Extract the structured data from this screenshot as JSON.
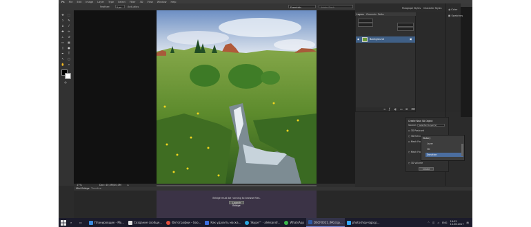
{
  "menubar": {
    "logo": "Ps",
    "items": [
      "File",
      "Edit",
      "Image",
      "Layer",
      "Type",
      "Select",
      "Filter",
      "3D",
      "View",
      "Window",
      "Help"
    ]
  },
  "options": {
    "essentials": "Essentials",
    "search_placeholder": "Adobe Stock",
    "label_feather": "Feather:",
    "feather_value": "0 px",
    "antialias": "Anti-alias"
  },
  "layers": {
    "tabs": [
      "Layers",
      "Channels",
      "Paths"
    ],
    "layer_name": "Background"
  },
  "panels_bar": {
    "tabs": [
      "Paragraph Styles",
      "Character Styles"
    ]
  },
  "right_panels": {
    "items": [
      "Color",
      "Swatches"
    ]
  },
  "panel3d": {
    "title": "Create New 3D Object",
    "source_label": "Source:",
    "source_value": "Selected Layer(s)",
    "options": [
      "3D Postcard",
      "3D Extrusion",
      "Mesh From Preset",
      "Mesh From Depth Map",
      "3D Volume"
    ],
    "create_label": "Create"
  },
  "popup": {
    "title": "History",
    "items": [
      "Layer",
      "3D",
      "Donation"
    ]
  },
  "status": {
    "zoom": "17%",
    "doc": "Doc: 40,0M/40,0M"
  },
  "bottom": {
    "tabs": [
      "Mini Bridge",
      "Timeline"
    ],
    "message": "Bridge must be running to browse files.",
    "button": "Launch Bridge"
  },
  "taskbar": {
    "items": [
      {
        "label": "Планировщик - Мо...",
        "color": "#3c8de0"
      },
      {
        "label": "Создание сообще...",
        "color": "#e0e0e0"
      },
      {
        "label": "Фотографии - Goo...",
        "color": "#e34d3c"
      },
      {
        "label": "Как удалить маска...",
        "color": "#3c6fe0"
      },
      {
        "label": "Skype™ - aleksandr...",
        "color": "#2aa7e0"
      },
      {
        "label": "WhatsApp",
        "color": "#3ab84a"
      },
      {
        "label": "DSCF0021_IMG3.jp...",
        "color": "#2d5aa6"
      },
      {
        "label": "photoshop-logo.jp...",
        "color": "#31a8ff"
      }
    ],
    "lang": "ENG",
    "time": "16:02",
    "date": "14.06.2017"
  }
}
